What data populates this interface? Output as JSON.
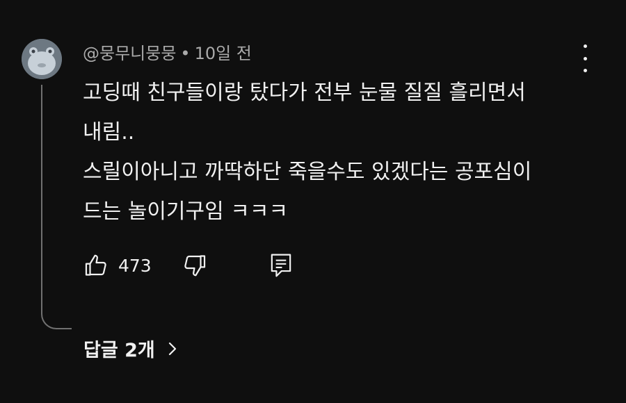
{
  "comment": {
    "author": "@뭉무니뭉뭉",
    "separator": "•",
    "time": "10일 전",
    "lines": [
      "고딩때 친구들이랑 탔다가 전부 눈물 질질 흘리면서",
      "내림..",
      "스릴이아니고 까딱하단 죽을수도 있겠다는 공포심이",
      "드는 놀이기구임 ㅋㅋㅋ"
    ],
    "like_count": "473",
    "replies_label": "답글 2개"
  },
  "icons": {
    "avatar": "avatar-image",
    "more": "more-vert-icon",
    "like": "thumbs-up-icon",
    "dislike": "thumbs-down-icon",
    "reply": "comment-icon",
    "chevron": "chevron-right-icon"
  },
  "colors": {
    "background": "#0f0f0f",
    "text": "#f1f1f1",
    "secondary_text": "#aaaaaa",
    "thread_line": "#717171"
  }
}
